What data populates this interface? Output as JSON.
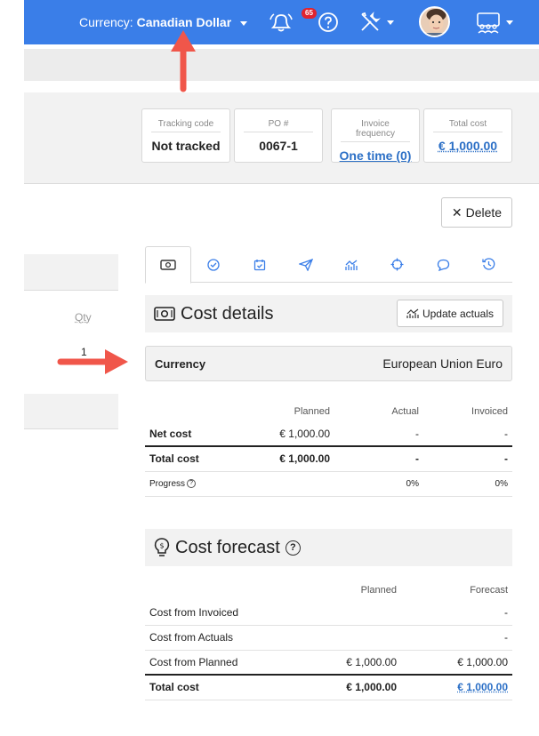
{
  "topbar": {
    "currency_label": "Currency:",
    "currency_value": "Canadian Dollar",
    "notifications_count": "65"
  },
  "summary": {
    "cards": [
      {
        "label": "Tracking code",
        "value": "Not tracked"
      },
      {
        "label": "PO #",
        "value": "0067-1"
      },
      {
        "label": "Invoice frequency",
        "value": "One time (0)"
      },
      {
        "label": "Total cost",
        "value": "€ 1,000.00"
      }
    ]
  },
  "actions": {
    "delete_label": "Delete"
  },
  "left": {
    "qty_header": "Qty",
    "qty_value": "1"
  },
  "cost_details": {
    "title": "Cost details",
    "update_actuals_label": "Update actuals",
    "currency_key": "Currency",
    "currency_value": "European Union Euro",
    "headers": [
      "Planned",
      "Actual",
      "Invoiced"
    ],
    "net_cost": {
      "label": "Net cost",
      "planned": "€ 1,000.00",
      "actual": "-",
      "invoiced": "-"
    },
    "total_cost": {
      "label": "Total cost",
      "planned": "€ 1,000.00",
      "actual": "-",
      "invoiced": "-"
    },
    "progress": {
      "label": "Progress",
      "actual": "0%",
      "invoiced": "0%"
    }
  },
  "cost_forecast": {
    "title": "Cost forecast",
    "headers": [
      "Planned",
      "Forecast"
    ],
    "rows": [
      {
        "label": "Cost from Invoiced",
        "planned": "",
        "forecast": "-"
      },
      {
        "label": "Cost from Actuals",
        "planned": "",
        "forecast": "-"
      },
      {
        "label": "Cost from Planned",
        "planned": "€ 1,000.00",
        "forecast": "€ 1,000.00"
      }
    ],
    "total": {
      "label": "Total cost",
      "planned": "€ 1,000.00",
      "forecast": "€ 1,000.00"
    }
  },
  "colors": {
    "topbar": "#3a7ee8",
    "link": "#2b6fc6",
    "arrow": "#f0564a",
    "badge": "#e0242f"
  }
}
